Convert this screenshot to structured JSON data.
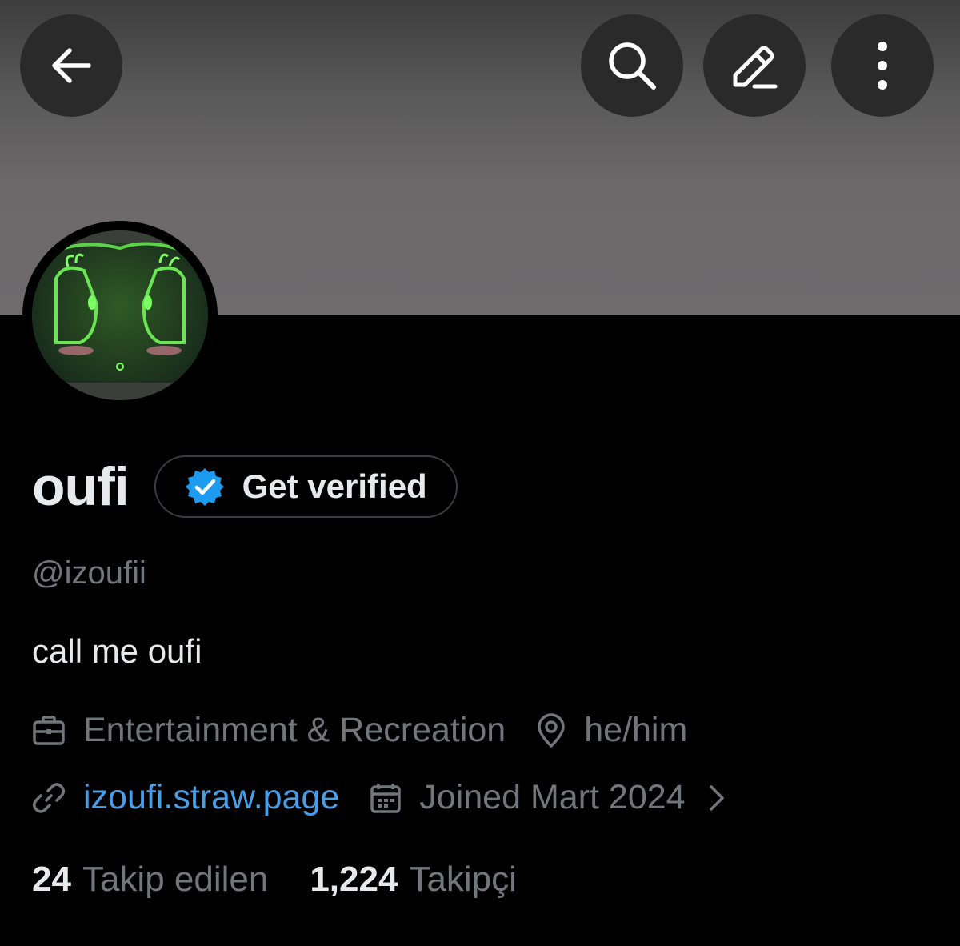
{
  "header": {
    "back_icon": "arrow-left-icon",
    "search_icon": "search-icon",
    "edit_icon": "edit-icon",
    "more_icon": "more-vertical-icon"
  },
  "profile": {
    "display_name": "oufi",
    "verify_label": "Get verified",
    "handle": "@izoufii",
    "bio": "call me oufi",
    "category": "Entertainment & Recreation",
    "location": "he/him",
    "website": "izoufi.straw.page",
    "joined": "Joined Mart 2024",
    "following_count": "24",
    "following_label": "Takip edilen",
    "followers_count": "1,224",
    "followers_label": "Takipçi"
  },
  "colors": {
    "background": "#000000",
    "banner": "#6b696a",
    "link": "#4a9ee8",
    "verified_badge": "#1d9bf0",
    "secondary_text": "#71767b"
  }
}
